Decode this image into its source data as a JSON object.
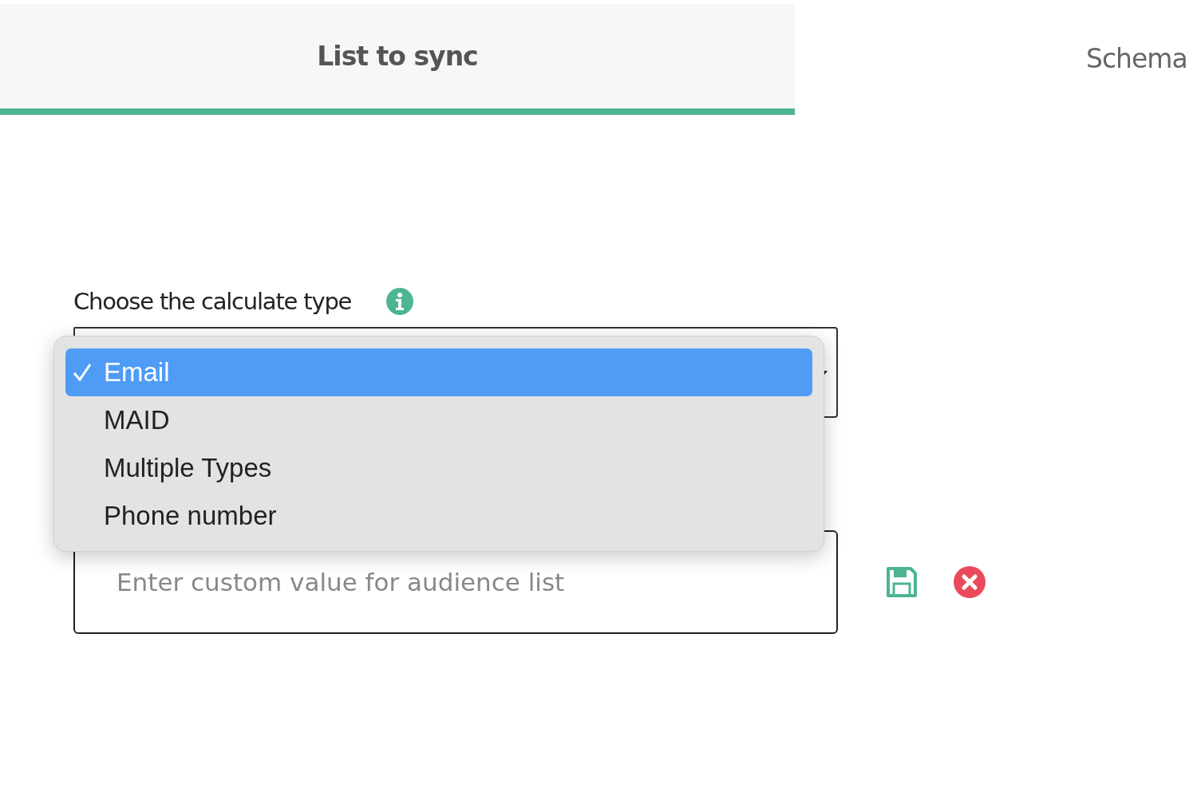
{
  "tabs": [
    {
      "label": "List to sync",
      "selected": true
    },
    {
      "label": "Schema",
      "selected": false
    }
  ],
  "calculate_type": {
    "label": "Choose the calculate type",
    "options": [
      {
        "label": "Email",
        "selected": true
      },
      {
        "label": "MAID",
        "selected": false
      },
      {
        "label": "Multiple Types",
        "selected": false
      },
      {
        "label": "Phone number",
        "selected": false
      }
    ]
  },
  "custom_value": {
    "placeholder": "Enter custom value for audience list"
  }
}
